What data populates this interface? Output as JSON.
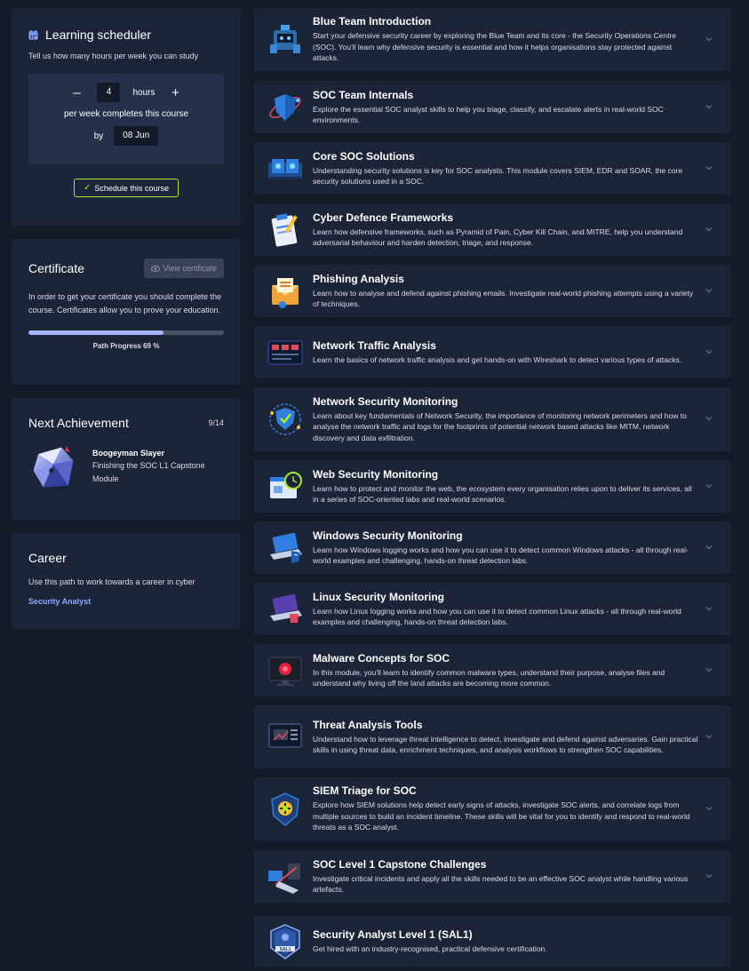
{
  "scheduler": {
    "title": "Learning scheduler",
    "subtitle": "Tell us how many hours per week you can study",
    "minus": "–",
    "plus": "+",
    "hours_value": "4",
    "hours_unit": "hours",
    "per_week_text": "per week completes this course",
    "by_label": "by",
    "date": "08 Jun",
    "button_label": "Schedule this course"
  },
  "certificate": {
    "title": "Certificate",
    "view_button": "View certificate",
    "description": "In order to get your certificate you should complete the course. Certificates allow you to prove your education.",
    "progress": 0.69,
    "progress_label": "Path Progress 69 %"
  },
  "achievement": {
    "title": "Next Achievement",
    "count": "9/14",
    "name": "Boogeyman Slayer",
    "description": "Finishing the SOC L1 Capstone Module"
  },
  "career": {
    "title": "Career",
    "description": "Use this path to work towards a career in cyber",
    "link": "Security Analyst"
  },
  "modules": [
    {
      "title": "Blue Team Introduction",
      "description": "Start your defensive security career by exploring the Blue Team and its core - the Security Operations Centre (SOC). You'll learn why defensive security is essential and how it helps organisations stay protected against attacks.",
      "icon": "blue-team-icon"
    },
    {
      "title": "SOC Team Internals",
      "description": "Explore the essential SOC analyst skills to help you triage, classify, and escalate alerts in real-world SOC environments.",
      "icon": "soc-shield-icon"
    },
    {
      "title": "Core SOC Solutions",
      "description": "Understanding security solutions is key for SOC analysts. This module covers SIEM, EDR and SOAR, the core security solutions used in a SOC.",
      "icon": "servers-icon"
    },
    {
      "title": "Cyber Defence Frameworks",
      "description": "Learn how defensive frameworks, such as Pyramid of Pain, Cyber Kill Chain, and MITRE, help you understand adversarial behaviour and harden detection, triage, and response.",
      "icon": "clipboard-icon"
    },
    {
      "title": "Phishing Analysis",
      "description": "Learn how to analyse and defend against phishing emails. Investigate real-world phishing attempts using a variety of techniques.",
      "icon": "envelope-icon"
    },
    {
      "title": "Network Traffic Analysis",
      "description": "Learn the basics of network traffic analysis and get hands-on with Wireshark to detect various types of attacks.",
      "icon": "network-monitor-icon"
    },
    {
      "title": "Network Security Monitoring",
      "description": "Learn about key fundamentals of Network Security, the importance of monitoring network perimeters and how to analyse the network traffic and logs for the footprints of potential network based attacks like MITM, network discovery and data exfiltration.",
      "icon": "network-shield-icon"
    },
    {
      "title": "Web Security Monitoring",
      "description": "Learn how to protect and monitor the web, the ecosystem every organisation relies upon to deliver its services, all in a series of SOC-oriented labs and real-world scenarios.",
      "icon": "web-clock-icon"
    },
    {
      "title": "Windows Security Monitoring",
      "description": "Learn how Windows logging works and how you can use it to detect common Windows attacks - all through real-world examples and challenging, hands-on threat detection labs.",
      "icon": "windows-laptop-icon"
    },
    {
      "title": "Linux Security Monitoring",
      "description": "Learn how Linux logging works and how you can use it to detect common Linux attacks - all through real-world examples and challenging, hands-on threat detection labs.",
      "icon": "linux-laptop-icon"
    },
    {
      "title": "Malware Concepts for SOC",
      "description": "In this module, you'll learn to identify common malware types, understand their purpose, analyse files and understand why living off the land attacks are becoming more common.",
      "icon": "malware-monitor-icon"
    },
    {
      "title": "Threat Analysis Tools",
      "description": "Understand how to leverage threat intelligence to detect, investigate and defend against adversaries. Gain practical skills in using threat data, enrichment techniques, and analysis workflows to strengthen SOC capabilities.",
      "icon": "analysis-monitor-icon"
    },
    {
      "title": "SIEM Triage for SOC",
      "description": "Explore how SIEM solutions help detect early signs of attacks, investigate SOC alerts, and correlate logs from multiple sources to build an incident timeline. These skills will be vital for you to identify and respond to real-world threats as a SOC analyst.",
      "icon": "siem-badge-icon"
    },
    {
      "title": "SOC Level 1 Capstone Challenges",
      "description": "Investigate critical incidents and apply all the skills needed to be an effective SOC analyst while handling various artefacts.",
      "icon": "capstone-icon"
    },
    {
      "title": "Security Analyst Level 1 (SAL1)",
      "description": "Get hired with an industry-recognised, practical defensive certification.",
      "icon": "sal1-badge-icon"
    }
  ],
  "colors": {
    "background": "#131a28",
    "panel": "#1c2538",
    "accent_green": "#a3ea2a",
    "progress_fill": "#a4b4fb",
    "link": "#8eaaff"
  }
}
